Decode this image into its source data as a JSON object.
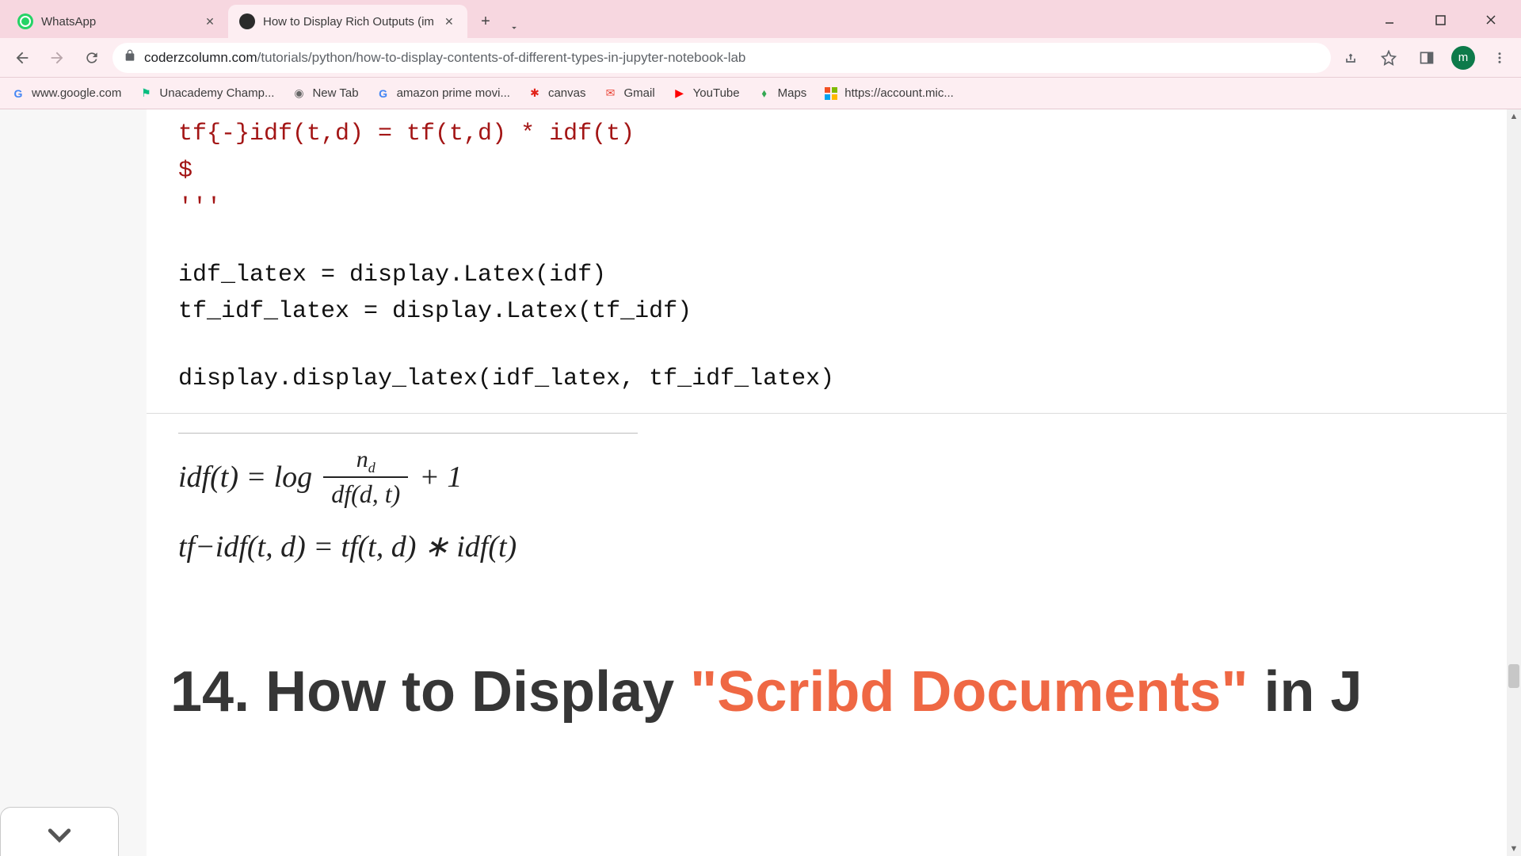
{
  "tabs": [
    {
      "title": "WhatsApp"
    },
    {
      "title": "How to Display Rich Outputs (im"
    }
  ],
  "url": {
    "domain": "coderzcolumn.com",
    "path": "/tutorials/python/how-to-display-contents-of-different-types-in-jupyter-notebook-lab"
  },
  "avatar_letter": "m",
  "bookmarks": [
    {
      "label": "www.google.com"
    },
    {
      "label": "Unacademy Champ..."
    },
    {
      "label": "New Tab"
    },
    {
      "label": "amazon prime movi..."
    },
    {
      "label": "canvas"
    },
    {
      "label": "Gmail"
    },
    {
      "label": "YouTube"
    },
    {
      "label": "Maps"
    },
    {
      "label": "https://account.mic..."
    }
  ],
  "code": {
    "l1": "tf{-}idf(t,d) = tf(t,d) * idf(t)",
    "l2": "$",
    "l3": "'''",
    "l4": "idf_latex = display.Latex(idf)",
    "l5": "tf_idf_latex = display.Latex(tf_idf)",
    "l6": "display.display_latex(idf_latex, tf_idf_latex)"
  },
  "latex": {
    "row1_left": "idf(t) = log",
    "row1_num": "n",
    "row1_num_sub": "d",
    "row1_den": "df(d, t)",
    "row1_right": "+ 1",
    "row2": "tf−idf(t, d) = tf(t, d) ∗ idf(t)"
  },
  "heading": {
    "pre": "14. How to Display ",
    "orange": "\"Scribd Documents\"",
    "post": " in J"
  }
}
